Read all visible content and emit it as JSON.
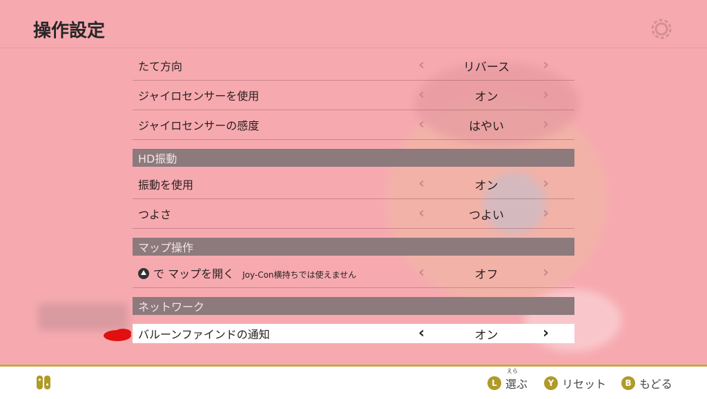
{
  "header": {
    "title": "操作設定",
    "settings_icon": "gear-icon"
  },
  "rows": [
    {
      "type": "item",
      "label": "たて方向",
      "value": "リバース"
    },
    {
      "type": "item",
      "label": "ジャイロセンサーを使用",
      "value": "オン"
    },
    {
      "type": "item",
      "label": "ジャイロセンサーの感度",
      "value": "はやい"
    },
    {
      "type": "section",
      "label": "HD振動"
    },
    {
      "type": "item",
      "label": "振動を使用",
      "value": "オン"
    },
    {
      "type": "item",
      "label": "つよさ",
      "value": "つよい"
    },
    {
      "type": "section",
      "label": "マップ操作"
    },
    {
      "type": "item",
      "label": "で マップを開く",
      "note": "Joy-Con横持ちでは使えません",
      "value": "オフ",
      "button_icon": "x-button-icon"
    },
    {
      "type": "section",
      "label": "ネットワーク"
    },
    {
      "type": "item",
      "label": "バルーンファインドの通知",
      "value": "オン",
      "selected": true
    }
  ],
  "footer": {
    "hints": [
      {
        "button": "L",
        "label": "選ぶ",
        "ruby": "えら"
      },
      {
        "button": "Y",
        "label": "リセット"
      },
      {
        "button": "B",
        "label": "もどる"
      }
    ]
  },
  "colors": {
    "background": "#f6aab0",
    "section_bg": "#8c7a7d",
    "footer_accent": "#c9a74a",
    "button_badge": "#b09a28"
  }
}
